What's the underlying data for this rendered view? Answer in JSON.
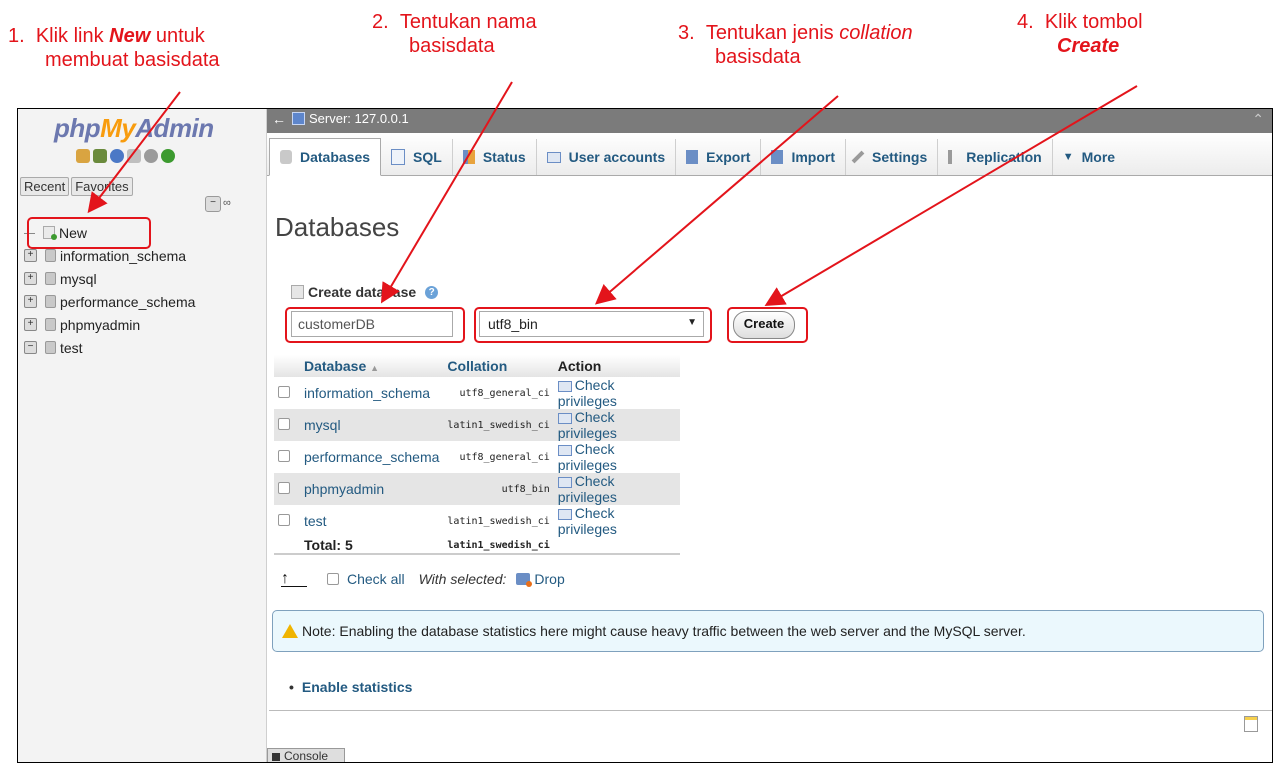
{
  "annotations": {
    "a1": {
      "num": "1.",
      "line1_pre": "Klik link ",
      "line1_bold": "New",
      "line1_post": " untuk",
      "line2": "membuat  basisdata"
    },
    "a2": {
      "num": "2.",
      "line1": "Tentukan nama",
      "line2": "basisdata"
    },
    "a3": {
      "num": "3.",
      "line1_pre": "Tentukan jenis ",
      "line1_ital": "collation",
      "line2": "basisdata"
    },
    "a4": {
      "num": "4.",
      "line1": "Klik tombol",
      "line2": "Create"
    },
    "color": "#e3141b"
  },
  "navigation": {
    "logo": {
      "php": "php",
      "my": "My",
      "admin": "Admin"
    },
    "tabs": [
      "Recent",
      "Favorites"
    ],
    "tree": [
      {
        "label": "New",
        "type": "new"
      },
      {
        "label": "information_schema",
        "type": "db"
      },
      {
        "label": "mysql",
        "type": "db"
      },
      {
        "label": "performance_schema",
        "type": "db"
      },
      {
        "label": "phpmyadmin",
        "type": "db"
      },
      {
        "label": "test",
        "type": "db"
      }
    ]
  },
  "topbar": {
    "server": "Server: 127.0.0.1"
  },
  "tabs": [
    {
      "label": "Databases",
      "icon": "database-icon",
      "active": true
    },
    {
      "label": "SQL",
      "icon": "sql-icon"
    },
    {
      "label": "Status",
      "icon": "status-icon"
    },
    {
      "label": "User accounts",
      "icon": "users-icon"
    },
    {
      "label": "Export",
      "icon": "export-icon"
    },
    {
      "label": "Import",
      "icon": "import-icon"
    },
    {
      "label": "Settings",
      "icon": "wrench-icon"
    },
    {
      "label": "Replication",
      "icon": "replication-icon"
    },
    {
      "label": "More",
      "icon": "caret-down-icon"
    }
  ],
  "content": {
    "title": "Databases",
    "create_label": "Create database",
    "dbname_value": "customerDB",
    "collation_value": "utf8_bin",
    "create_button": "Create",
    "table": {
      "headers": {
        "database": "Database",
        "sort_arrow": "▲",
        "collation": "Collation",
        "action": "Action"
      },
      "rows": [
        {
          "name": "information_schema",
          "collation": "utf8_general_ci",
          "action": "Check privileges"
        },
        {
          "name": "mysql",
          "collation": "latin1_swedish_ci",
          "action": "Check privileges"
        },
        {
          "name": "performance_schema",
          "collation": "utf8_general_ci",
          "action": "Check privileges"
        },
        {
          "name": "phpmyadmin",
          "collation": "utf8_bin",
          "action": "Check privileges"
        },
        {
          "name": "test",
          "collation": "latin1_swedish_ci",
          "action": "Check privileges"
        }
      ],
      "total_label": "Total: 5",
      "total_collation": "latin1_swedish_ci"
    },
    "bulk": {
      "check_all": "Check all",
      "with_selected": "With selected:",
      "drop": "Drop"
    },
    "note": "Note: Enabling the database statistics here might cause heavy traffic between the web server and the MySQL server.",
    "enable_statistics": "Enable statistics",
    "console": "Console"
  }
}
